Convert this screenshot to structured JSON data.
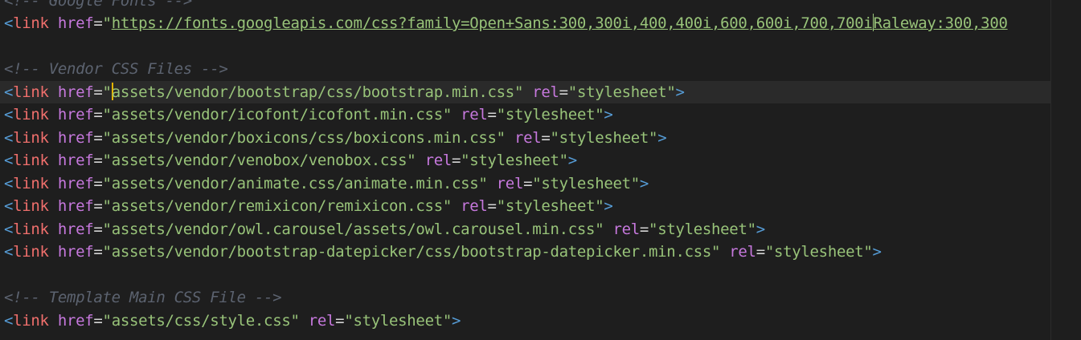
{
  "editor": {
    "lines": [
      {
        "kind": "comment",
        "text": "<!-- Google Fonts -->"
      },
      {
        "kind": "fonts",
        "tag": "<link",
        "attr": "href",
        "url_a": "https://fonts.googleapis.com/css?family=Open+Sans:300,300i,400,400i,600,600i,700,700i",
        "url_b": "Raleway:300,300"
      },
      {
        "kind": "blank"
      },
      {
        "kind": "comment",
        "text": "<!-- Vendor CSS Files -->"
      },
      {
        "kind": "link",
        "current": true,
        "tag": "<link",
        "attr": "href",
        "href": "assets/vendor/bootstrap/css/bootstrap.min.css",
        "rel_attr": "rel",
        "rel": "stylesheet",
        "close": ">"
      },
      {
        "kind": "link",
        "tag": "<link",
        "attr": "href",
        "href": "assets/vendor/icofont/icofont.min.css",
        "rel_attr": "rel",
        "rel": "stylesheet",
        "close": ">"
      },
      {
        "kind": "link",
        "tag": "<link",
        "attr": "href",
        "href": "assets/vendor/boxicons/css/boxicons.min.css",
        "rel_attr": "rel",
        "rel": "stylesheet",
        "close": ">"
      },
      {
        "kind": "link",
        "tag": "<link",
        "attr": "href",
        "href": "assets/vendor/venobox/venobox.css",
        "rel_attr": "rel",
        "rel": "stylesheet",
        "close": ">"
      },
      {
        "kind": "link",
        "tag": "<link",
        "attr": "href",
        "href": "assets/vendor/animate.css/animate.min.css",
        "rel_attr": "rel",
        "rel": "stylesheet",
        "close": ">"
      },
      {
        "kind": "link",
        "tag": "<link",
        "attr": "href",
        "href": "assets/vendor/remixicon/remixicon.css",
        "rel_attr": "rel",
        "rel": "stylesheet",
        "close": ">"
      },
      {
        "kind": "link",
        "tag": "<link",
        "attr": "href",
        "href": "assets/vendor/owl.carousel/assets/owl.carousel.min.css",
        "rel_attr": "rel",
        "rel": "stylesheet",
        "close": ">"
      },
      {
        "kind": "link",
        "tag": "<link",
        "attr": "href",
        "href": "assets/vendor/bootstrap-datepicker/css/bootstrap-datepicker.min.css",
        "rel_attr": "rel",
        "rel": "stylesheet",
        "close": ">"
      },
      {
        "kind": "blank"
      },
      {
        "kind": "comment",
        "text": "<!-- Template Main CSS File -->"
      },
      {
        "kind": "link",
        "tag": "<link",
        "attr": "href",
        "href": "assets/css/style.css",
        "rel_attr": "rel",
        "rel": "stylesheet",
        "close": ">"
      }
    ]
  },
  "colors": {
    "background": "#1e1e1e",
    "current_line": "#2a2a2a",
    "tag_punctuation": "#569cd6",
    "tag_name": "#ef6f6c",
    "attribute": "#c678dd",
    "string": "#98c379",
    "comment": "#5c6370",
    "cursor": "#e5b400"
  }
}
